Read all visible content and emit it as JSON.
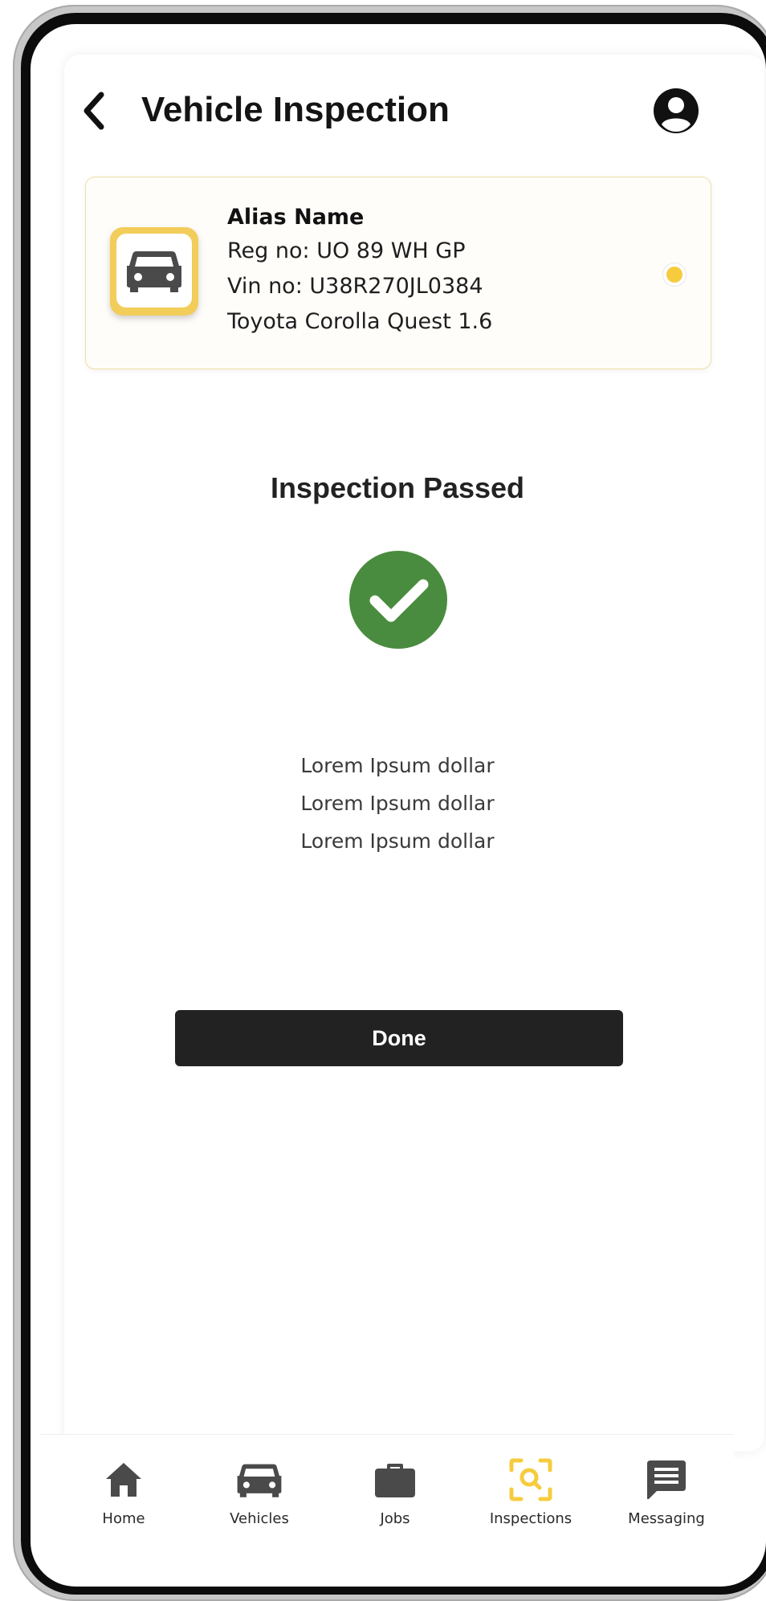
{
  "header": {
    "title": "Vehicle Inspection",
    "back_icon": "chevron-left-icon",
    "profile_icon": "user-circle-icon"
  },
  "vehicle": {
    "alias": "Alias Name",
    "reg": "Reg no: UO 89 WH GP",
    "vin": "Vin no: U38R270JL0384",
    "model": "Toyota Corolla Quest 1.6",
    "icon": "car-icon",
    "selected": true
  },
  "result": {
    "title": "Inspection Passed",
    "icon": "check-circle-icon",
    "lines": [
      "Lorem Ipsum dollar",
      "Lorem Ipsum dollar",
      "Lorem Ipsum dollar"
    ]
  },
  "actions": {
    "done_label": "Done"
  },
  "bottom_nav": {
    "active_index": 3,
    "items": [
      {
        "label": "Home",
        "icon": "home-icon"
      },
      {
        "label": "Vehicles",
        "icon": "car-icon"
      },
      {
        "label": "Jobs",
        "icon": "briefcase-icon"
      },
      {
        "label": "Inspections",
        "icon": "scan-search-icon"
      },
      {
        "label": "Messaging",
        "icon": "message-icon"
      }
    ]
  },
  "colors": {
    "accent": "#f6cc3e",
    "success": "#4a8c3f",
    "icon_dark": "#4a4a4a",
    "button_dark": "#222222"
  }
}
